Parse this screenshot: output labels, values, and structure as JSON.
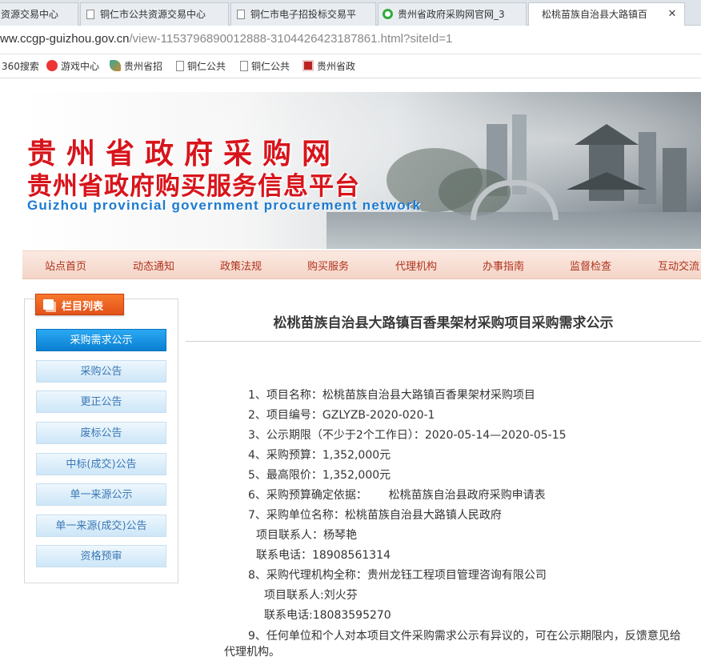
{
  "browser": {
    "tabs": [
      {
        "title": "资源交易中心"
      },
      {
        "title": "铜仁市公共资源交易中心"
      },
      {
        "title": "铜仁市电子招投标交易平"
      },
      {
        "title": "贵州省政府采购网官网_3"
      },
      {
        "title": "松桃苗族自治县大路镇百"
      }
    ],
    "close_glyph": "✕",
    "url_host": "ww.ccgp-guizhou.gov.cn",
    "url_path": "/view-1153796890012888-3104426423187861.html?siteId=1",
    "bookmarks": [
      "360搜索",
      "游戏中心",
      "贵州省招",
      "铜仁公共",
      "铜仁公共",
      "贵州省政"
    ]
  },
  "site": {
    "title_cn": "贵州省政府采购网",
    "subtitle_cn": "贵州省政府购买服务信息平台",
    "title_en": "Guizhou provincial government procurement network",
    "nav": [
      "站点首页",
      "动态通知",
      "政策法规",
      "购买服务",
      "代理机构",
      "办事指南",
      "监督检查",
      "互动交流"
    ]
  },
  "sidebar": {
    "heading": "栏目列表",
    "items": [
      {
        "label": "采购需求公示",
        "active": true
      },
      {
        "label": "采购公告",
        "active": false
      },
      {
        "label": "更正公告",
        "active": false
      },
      {
        "label": "废标公告",
        "active": false
      },
      {
        "label": "中标(成交)公告",
        "active": false
      },
      {
        "label": "单一来源公示",
        "active": false
      },
      {
        "label": "单一来源(成交)公告",
        "active": false
      },
      {
        "label": "资格预审",
        "active": false
      }
    ]
  },
  "article": {
    "title": "松桃苗族自治县大路镇百香果架材采购项目采购需求公示",
    "lines": [
      "1、项目名称：松桃苗族自治县大路镇百香果架材采购项目",
      "2、项目编号：GZLYZB-2020-020-1",
      "3、公示期限（不少于2个工作日）：2020-05-14—2020-05-15",
      "4、采购预算：1,352,000元",
      "5、最高限价：1,352,000元",
      "6、采购预算确定依据：      松桃苗族自治县政府采购申请表",
      "7、采购单位名称：松桃苗族自治县大路镇人民政府",
      "项目联系人：杨琴艳",
      "联系电话：18908561314",
      "8、采购代理机构全称：贵州龙钰工程项目管理咨询有限公司",
      "项目联系人:刘火芬",
      "联系电话:18083595270",
      "9、任何单位和个人对本项目文件采购需求公示有异议的，可在公示期限内，反馈意见给代理机构。"
    ]
  }
}
